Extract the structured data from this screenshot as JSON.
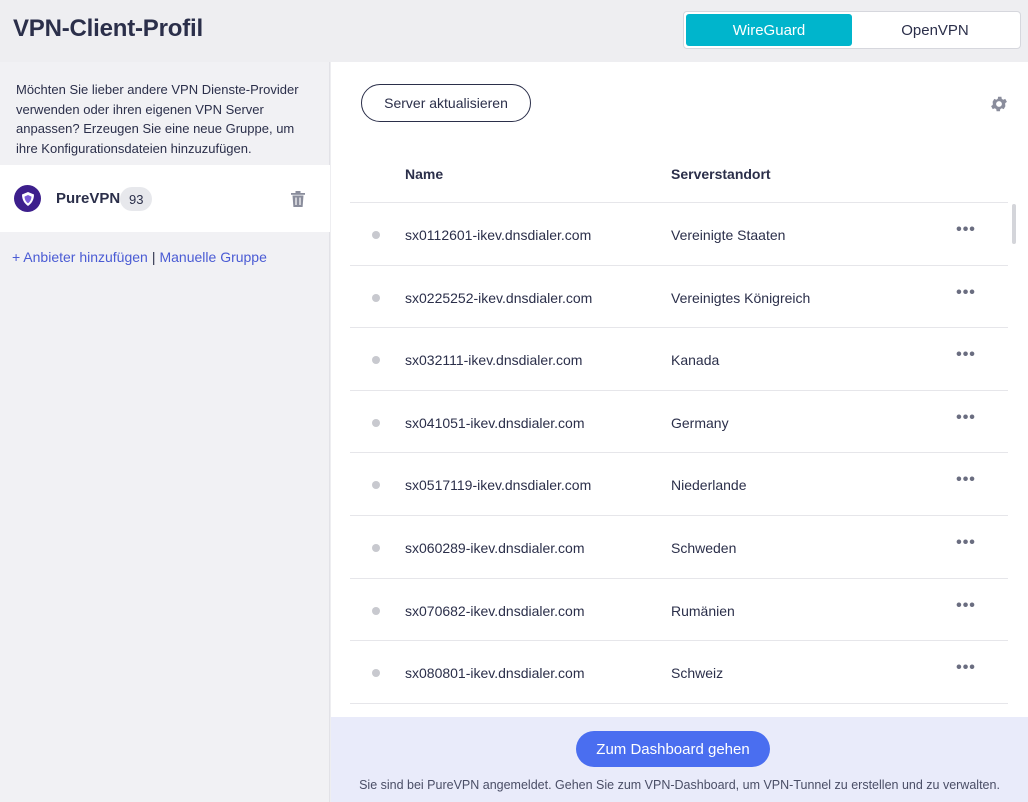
{
  "header": {
    "title": "VPN-Client-Profil",
    "protocols": [
      {
        "label": "WireGuard",
        "active": true
      },
      {
        "label": "OpenVPN",
        "active": false
      }
    ]
  },
  "sidebar": {
    "description": "Möchten Sie lieber andere VPN Dienste-Provider verwenden oder ihren eigenen VPN Server anpassen? Erzeugen Sie eine neue Gruppe, um ihre Konfigurationsdateien hinzuzufügen.",
    "provider": {
      "name": "PureVPN",
      "count": "93",
      "logo_color": "#3d1f8c"
    },
    "add_provider_label": "+ Anbieter hinzufügen",
    "separator": "|",
    "manual_group_label": "Manuelle Gruppe"
  },
  "main": {
    "refresh_label": "Server aktualisieren",
    "columns": {
      "name": "Name",
      "location": "Serverstandort"
    },
    "rows": [
      {
        "name": "sx0112601-ikev.dnsdialer.com",
        "location": "Vereinigte Staaten"
      },
      {
        "name": "sx0225252-ikev.dnsdialer.com",
        "location": "Vereinigtes Königreich"
      },
      {
        "name": "sx032111-ikev.dnsdialer.com",
        "location": "Kanada"
      },
      {
        "name": "sx041051-ikev.dnsdialer.com",
        "location": "Germany"
      },
      {
        "name": "sx0517119-ikev.dnsdialer.com",
        "location": "Niederlande"
      },
      {
        "name": "sx060289-ikev.dnsdialer.com",
        "location": "Schweden"
      },
      {
        "name": "sx070682-ikev.dnsdialer.com",
        "location": "Rumänien"
      },
      {
        "name": "sx080801-ikev.dnsdialer.com",
        "location": "Schweiz"
      }
    ],
    "more_glyph": "•••"
  },
  "footer": {
    "dashboard_label": "Zum Dashboard gehen",
    "note": "Sie sind bei PureVPN angemeldet. Gehen Sie zum VPN-Dashboard, um VPN-Tunnel zu erstellen und zu verwalten."
  },
  "colors": {
    "accent_cyan": "#00b5cc",
    "accent_blue": "#4a6ef0",
    "link_blue": "#4a5bd4",
    "text_dark": "#2b2f4a"
  },
  "icons": [
    "shield-icon",
    "trash-icon",
    "gear-icon",
    "more-options-icon",
    "status-dot-icon"
  ]
}
